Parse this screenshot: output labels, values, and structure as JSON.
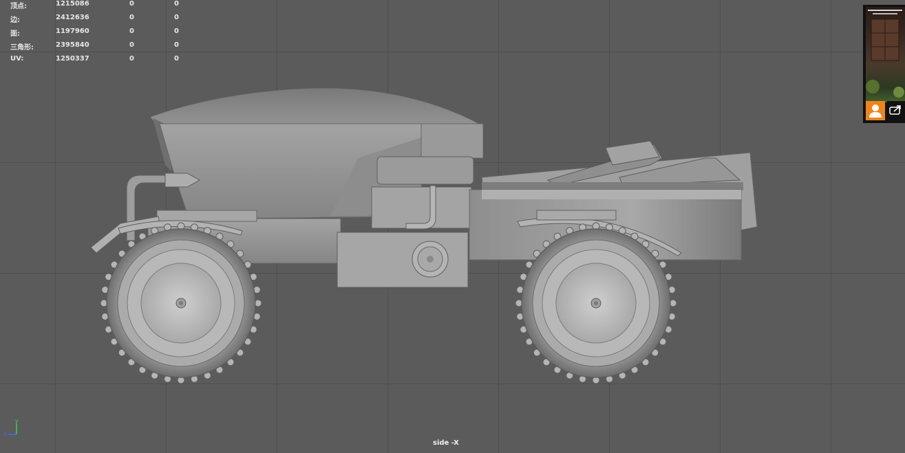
{
  "hud": {
    "stats": [
      {
        "label": "顶点:",
        "total": "1215086",
        "selected": "0",
        "selected2": "0"
      },
      {
        "label": "边:",
        "total": "2412636",
        "selected": "0",
        "selected2": "0"
      },
      {
        "label": "面:",
        "total": "1197960",
        "selected": "0",
        "selected2": "0"
      },
      {
        "label": "三角形:",
        "total": "2395840",
        "selected": "0",
        "selected2": "0"
      },
      {
        "label": "UV:",
        "total": "1250337",
        "selected": "0",
        "selected2": "0"
      }
    ]
  },
  "viewport": {
    "camera_label": "side -X",
    "background_color": "#5b5b5b",
    "grid_color": "#4e4e4e"
  },
  "axis_gizmo": {
    "y_label": "y",
    "z_label": "z",
    "y_color": "#3fd13f",
    "z_color": "#3b6cff"
  },
  "video_overlay": {
    "user_icon": "person-icon",
    "share_icon": "share-icon",
    "accent_color": "#f0841a"
  }
}
